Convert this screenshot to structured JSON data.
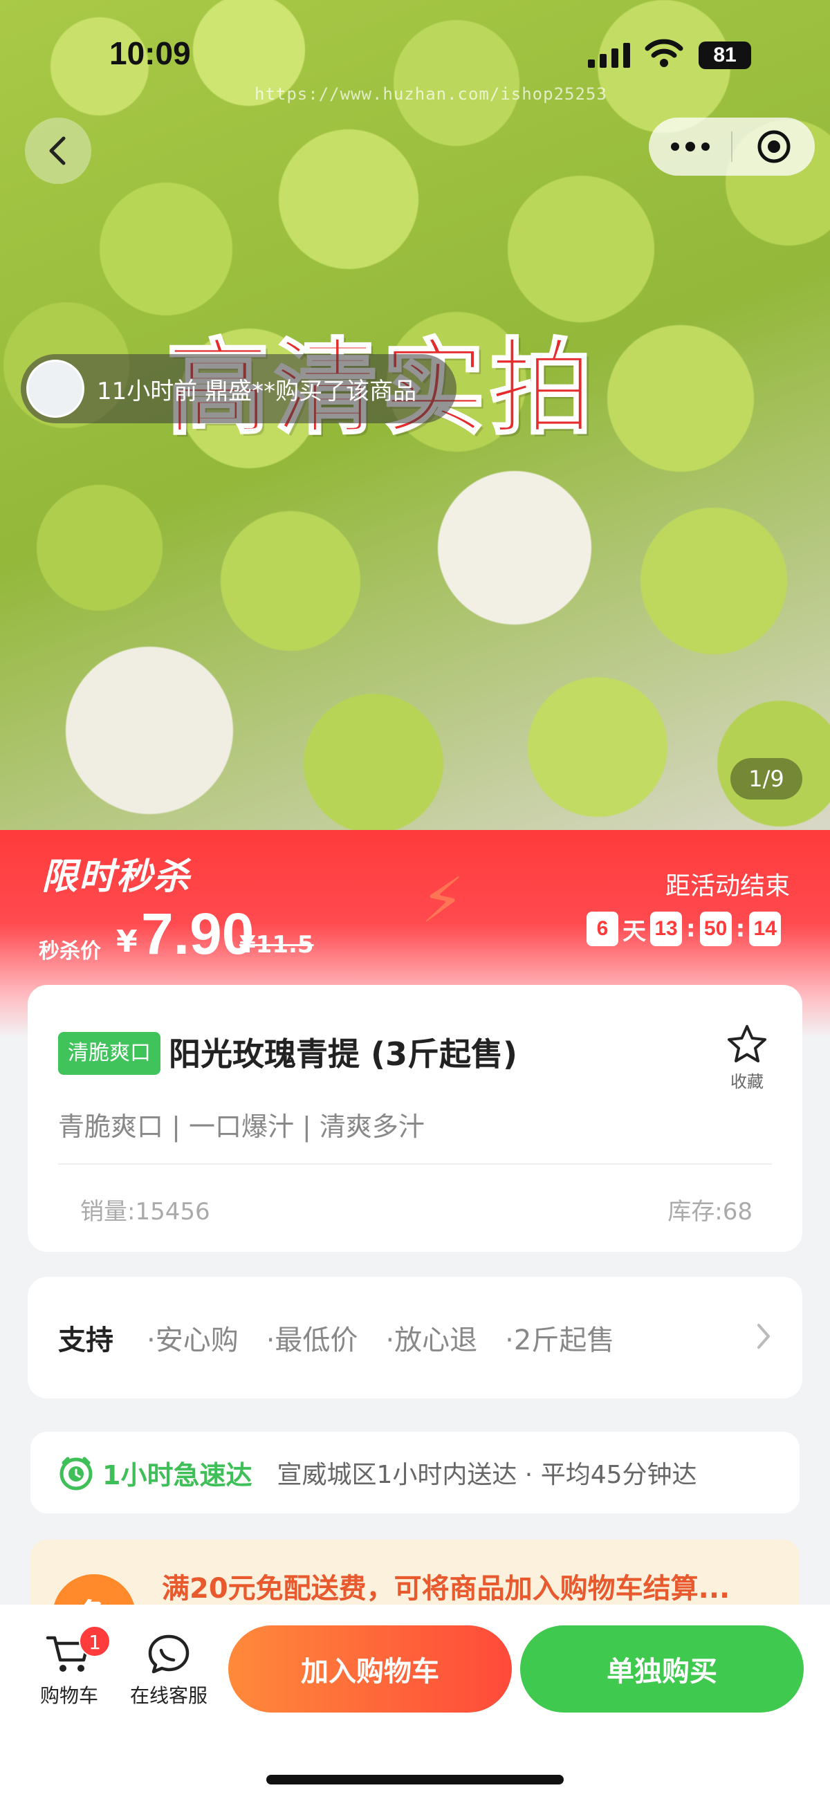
{
  "status_bar": {
    "time": "10:09",
    "battery": "81"
  },
  "watermark": "https://www.huzhan.com/ishop25253",
  "hero": {
    "overlay_title": "高清实拍",
    "ticker": "11小时前  鼎盛**购买了该商品",
    "page_counter": "1/9"
  },
  "flash_sale": {
    "logo": "限时秒杀",
    "price_label": "秒杀价",
    "currency": "¥",
    "price": "7.90",
    "original_price": "¥11.5",
    "ends_label": "距活动结束",
    "countdown": {
      "days": "6",
      "day_unit": "天",
      "hours": "13",
      "minutes": "50",
      "seconds": "14",
      "sep": ":"
    }
  },
  "product": {
    "tag": "清脆爽口",
    "title": "阳光玫瑰青提 (3斤起售)",
    "favorite_label": "收藏",
    "features": "青脆爽口 | 一口爆汁 | 清爽多汁",
    "sales": "销量:15456",
    "stock": "库存:68"
  },
  "support": {
    "title": "支持",
    "items": [
      "·安心购",
      "·最低价",
      "·放心退",
      "·2斤起售"
    ]
  },
  "delivery": {
    "title": "1小时急速达",
    "desc": "宣威城区1小时内送达 · 平均45分钟达"
  },
  "free_shipping": {
    "icon_text": "免",
    "text": "满20元免配送费，可将商品加入购物车结算..."
  },
  "bottom_bar": {
    "cart_label": "购物车",
    "cart_badge": "1",
    "service_label": "在线客服",
    "add_to_cart": "加入购物车",
    "buy_now": "单独购买"
  }
}
